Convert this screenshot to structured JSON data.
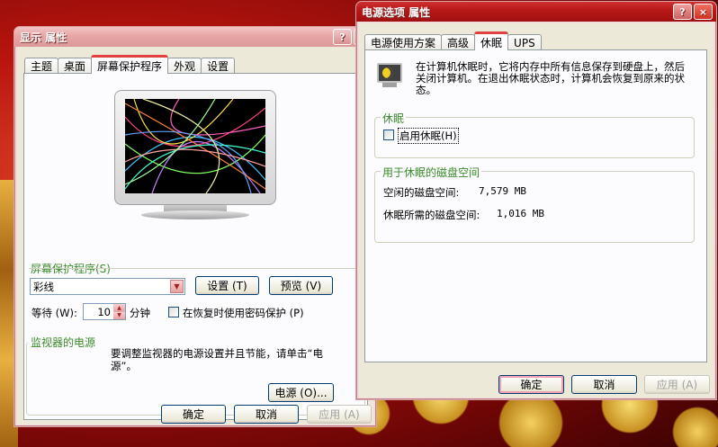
{
  "display_window": {
    "title": "显示 属性",
    "help_btn": "?",
    "close_btn": "×",
    "tabs": [
      "主题",
      "桌面",
      "屏幕保护程序",
      "外观",
      "设置"
    ],
    "active_tab": "屏幕保护程序",
    "screensaver_group": "屏幕保护程序(S)",
    "screensaver_selected": "彩线",
    "settings_btn": "设置 (T)",
    "preview_btn": "预览 (V)",
    "wait_label": "等待 (W):",
    "wait_value": "10",
    "wait_unit": "分钟",
    "password_checkbox_label": "在恢复时使用密码保护 (P)",
    "monitor_power_group": "监视器的电源",
    "monitor_power_text": "要调整监视器的电源设置并且节能，请单击“电源”。",
    "power_btn": "电源 (O)...",
    "ok_btn": "确定",
    "cancel_btn": "取消",
    "apply_btn": "应用 (A)"
  },
  "power_window": {
    "title": "电源选项 属性",
    "help_btn": "?",
    "close_btn": "×",
    "tabs": [
      "电源使用方案",
      "高级",
      "休眠",
      "UPS"
    ],
    "active_tab": "休眠",
    "description": "在计算机休眠时，它将内存中所有信息保存到硬盘上，然后关闭计算机。在退出休眠状态时，计算机会恢复到原来的状态。",
    "hibernate_group": "休眠",
    "enable_hibernate_label": "启用休眠(H)",
    "enable_hibernate_checked": false,
    "disk_space_group": "用于休眠的磁盘空间",
    "free_space_label": "空闲的磁盘空间:",
    "free_space_value": "7,579 MB",
    "required_space_label": "休眠所需的磁盘空间:",
    "required_space_value": "1,016 MB",
    "ok_btn": "确定",
    "cancel_btn": "取消",
    "apply_btn": "应用 (A)"
  },
  "colors": {
    "accent": "#e04040",
    "group_title": "#3a8a2a",
    "left_title_bg": "#e8a8a8",
    "right_title_bg": "#b81818"
  }
}
